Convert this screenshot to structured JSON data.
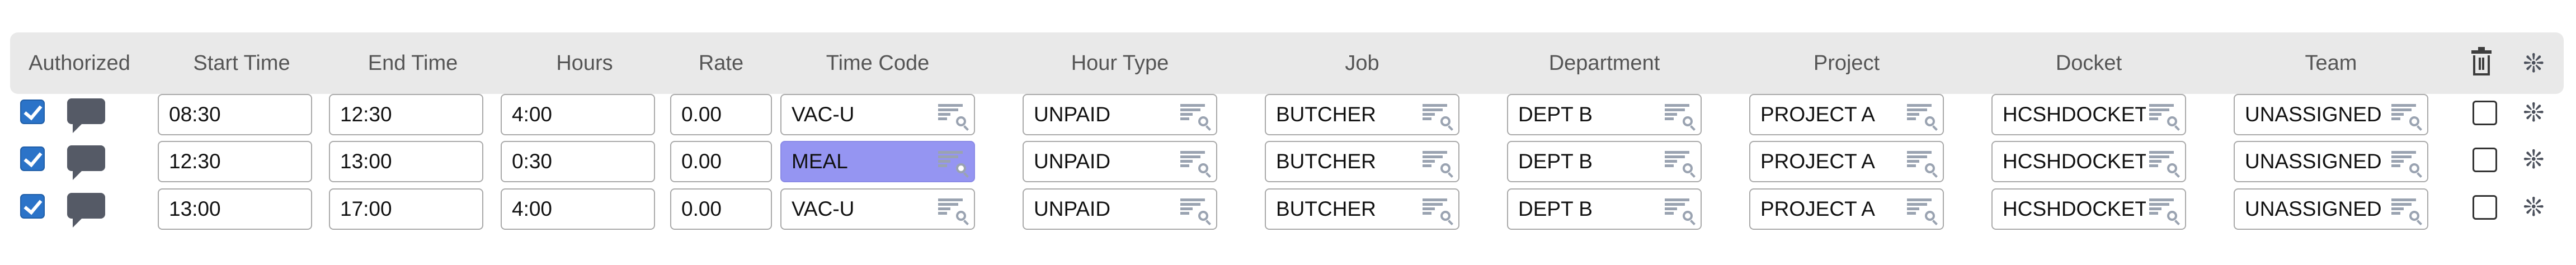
{
  "headers": {
    "authorized": "Authorized",
    "start_time": "Start Time",
    "end_time": "End Time",
    "hours": "Hours",
    "rate": "Rate",
    "time_code": "Time Code",
    "hour_type": "Hour Type",
    "job": "Job",
    "department": "Department",
    "project": "Project",
    "docket": "Docket",
    "team": "Team"
  },
  "icons": {
    "delete_header": "trash-icon",
    "settings_header": "snowflake-gear-icon",
    "comment": "comment-bubble-icon",
    "lookup": "list-search-icon",
    "row_settings": "snowflake-gear-icon"
  },
  "colors": {
    "checkbox_checked": "#2b73c8",
    "selected_field": "#9595f2",
    "header_band": "#e9e9e9"
  },
  "rows": [
    {
      "authorized": true,
      "start": "08:30",
      "end": "12:30",
      "hours": "4:00",
      "rate": "0.00",
      "time_code": "VAC-U",
      "hour_type": "UNPAID",
      "job": "BUTCHER",
      "department": "DEPT B",
      "project": "PROJECT A",
      "docket": "HCSHDOCKET",
      "team": "UNASSIGNED",
      "selected": false
    },
    {
      "authorized": true,
      "start": "12:30",
      "end": "13:00",
      "hours": "0:30",
      "rate": "0.00",
      "time_code": "MEAL",
      "hour_type": "UNPAID",
      "job": "BUTCHER",
      "department": "DEPT B",
      "project": "PROJECT A",
      "docket": "HCSHDOCKET",
      "team": "UNASSIGNED",
      "selected": false
    },
    {
      "authorized": true,
      "start": "13:00",
      "end": "17:00",
      "hours": "4:00",
      "rate": "0.00",
      "time_code": "VAC-U",
      "hour_type": "UNPAID",
      "job": "BUTCHER",
      "department": "DEPT B",
      "project": "PROJECT A",
      "docket": "HCSHDOCKET",
      "team": "UNASSIGNED",
      "selected": false
    }
  ],
  "symbols": {
    "asterisk": "❊"
  }
}
